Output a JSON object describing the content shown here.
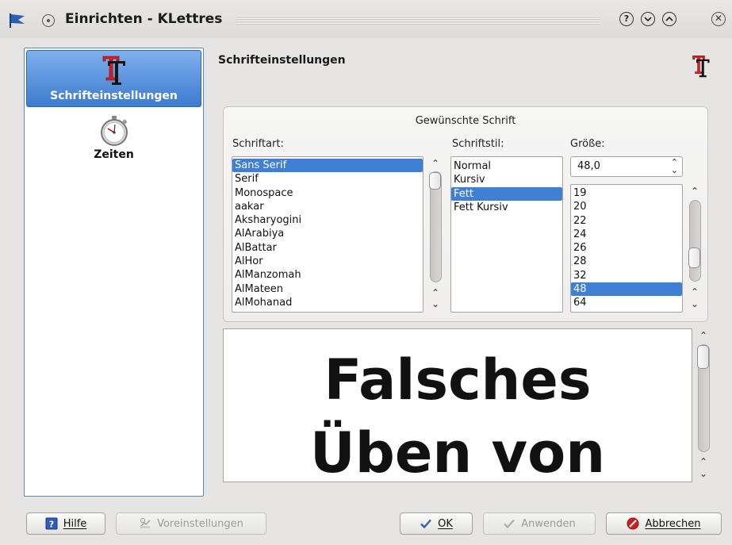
{
  "window": {
    "title": "Einrichten - KLettres",
    "buttons": {
      "help": "?",
      "minimize": "⌄",
      "maximize": "⌃",
      "close": "✕"
    }
  },
  "sidebar": {
    "items": [
      {
        "label": "Schrifteinstellungen",
        "icon": "font-icon",
        "selected": true
      },
      {
        "label": "Zeiten",
        "icon": "stopwatch-icon",
        "selected": false
      }
    ]
  },
  "page": {
    "title": "Schrifteinstellungen",
    "icon": "font-icon"
  },
  "font_group": {
    "title": "Gewünschte Schrift",
    "family": {
      "label": "Schriftart:",
      "items": [
        "Sans Serif",
        "Serif",
        "Monospace",
        "aakar",
        "Aksharyogini",
        "AlArabiya",
        "AlBattar",
        "AlHor",
        "AlManzomah",
        "AlMateen",
        "AlMohanad"
      ],
      "selected": "Sans Serif"
    },
    "style": {
      "label": "Schriftstil:",
      "items": [
        "Normal",
        "Kursiv",
        "Fett",
        "Fett Kursiv"
      ],
      "selected": "Fett"
    },
    "size": {
      "label": "Größe:",
      "value": "48,0",
      "items": [
        "19",
        "20",
        "22",
        "24",
        "26",
        "28",
        "32",
        "48",
        "64"
      ],
      "selected": "48"
    }
  },
  "preview": {
    "lines": [
      "Falsches",
      "Üben von"
    ]
  },
  "buttons": {
    "help": {
      "label": "Hilfe",
      "icon": "help-book-icon"
    },
    "defaults": {
      "label": "Voreinstellungen",
      "icon": "defaults-icon",
      "enabled": false
    },
    "ok": {
      "label": "OK",
      "icon": "checkmark-icon"
    },
    "apply": {
      "label": "Anwenden",
      "icon": "checkmark-icon",
      "enabled": false
    },
    "cancel": {
      "label": "Abbrechen",
      "icon": "cancel-icon"
    }
  },
  "colors": {
    "selection": "#3f7fd4",
    "sidebar_active": "#3d7bd0",
    "cancel_red": "#d01f1f"
  }
}
